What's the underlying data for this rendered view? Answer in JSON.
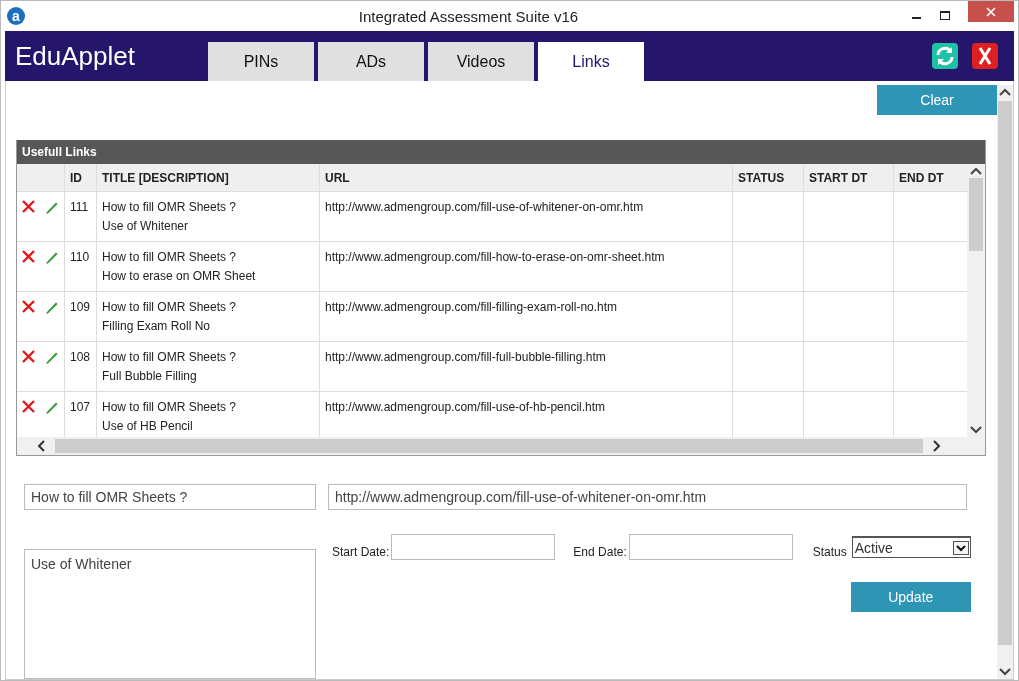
{
  "window": {
    "title": "Integrated Assessment Suite v16",
    "icon_letter": "a"
  },
  "app": {
    "name": "EduApplet"
  },
  "tabs": [
    {
      "label": "PINs",
      "selected": false
    },
    {
      "label": "ADs",
      "selected": false
    },
    {
      "label": "Videos",
      "selected": false
    },
    {
      "label": "Links",
      "selected": true
    }
  ],
  "toolbar": {
    "clear": "Clear"
  },
  "grid": {
    "title": "Usefull Links",
    "columns": [
      "ID",
      "TITLE [DESCRIPTION]",
      "URL",
      "STATUS",
      "START DT",
      "END DT"
    ],
    "rows": [
      {
        "id": "111",
        "title": "How to fill OMR Sheets ?",
        "description": "Use of Whitener",
        "url": "http://www.admengroup.com/fill-use-of-whitener-on-omr.htm"
      },
      {
        "id": "110",
        "title": "How to fill OMR Sheets ?",
        "description": "How to erase on OMR Sheet",
        "url": "http://www.admengroup.com/fill-how-to-erase-on-omr-sheet.htm"
      },
      {
        "id": "109",
        "title": "How to fill OMR Sheets ?",
        "description": "Filling Exam Roll No",
        "url": "http://www.admengroup.com/fill-filling-exam-roll-no.htm"
      },
      {
        "id": "108",
        "title": "How to fill OMR Sheets ?",
        "description": "Full Bubble Filling",
        "url": "http://www.admengroup.com/fill-full-bubble-filling.htm"
      },
      {
        "id": "107",
        "title": "How to fill OMR Sheets ?",
        "description": "Use of HB Pencil",
        "url": "http://www.admengroup.com/fill-use-of-hb-pencil.htm"
      }
    ]
  },
  "form": {
    "title": "How to fill OMR Sheets ?",
    "url": "http://www.admengroup.com/fill-use-of-whitener-on-omr.htm",
    "description": "Use of Whitener",
    "start_label": "Start Date:",
    "end_label": "End Date:",
    "status_label": "Status",
    "status": "Active",
    "update": "Update"
  }
}
